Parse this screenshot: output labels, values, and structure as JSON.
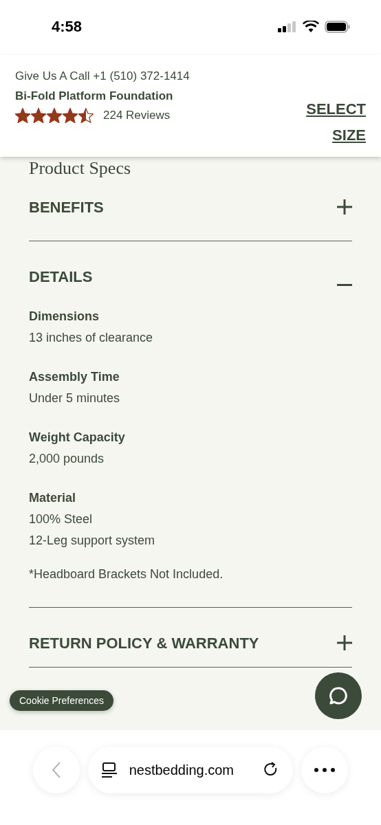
{
  "status_bar": {
    "time": "4:58"
  },
  "header": {
    "call": "Give Us A Call +1 (510) 372-1414",
    "product": "Bi-Fold Platform Foundation",
    "stars": 4.5,
    "reviews": "224 Reviews",
    "select_size": "SELECT SIZE"
  },
  "page_title": "Product Specs",
  "sections": [
    {
      "title": "BENEFITS",
      "expanded": false
    },
    {
      "title": "DETAILS",
      "expanded": true,
      "specs": [
        {
          "label": "Dimensions",
          "lines": [
            "13 inches of clearance"
          ]
        },
        {
          "label": "Assembly Time",
          "lines": [
            "Under 5 minutes"
          ]
        },
        {
          "label": "Weight Capacity",
          "lines": [
            "2,000 pounds"
          ]
        },
        {
          "label": "Material",
          "lines": [
            "100% Steel",
            "12-Leg support system"
          ]
        }
      ],
      "note": "*Headboard Brackets Not Included."
    },
    {
      "title": "RETURN POLICY & WARRANTY",
      "expanded": false
    }
  ],
  "cookie_button": "Cookie Preferences",
  "browser": {
    "url": "nestbedding.com"
  }
}
